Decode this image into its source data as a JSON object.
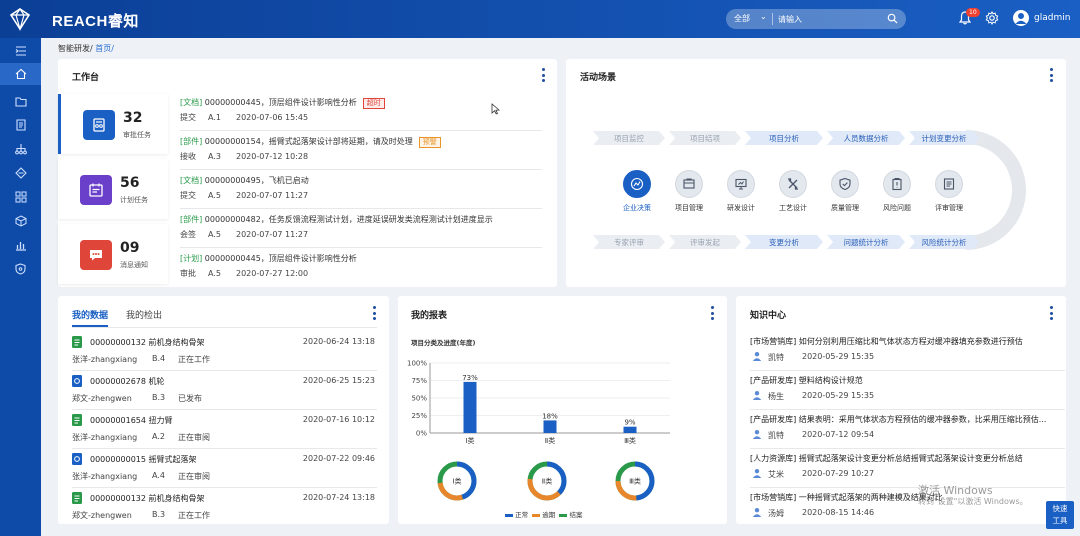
{
  "brand": "REACH睿知",
  "search": {
    "scope": "全部",
    "placeholder": "请输入"
  },
  "notifications": {
    "count": "10"
  },
  "user": {
    "name": "gladmin"
  },
  "breadcrumb": {
    "root": "智能研发/",
    "current": "首页/"
  },
  "workbench": {
    "title": "工作台",
    "stats": [
      {
        "value": "32",
        "label": "审批任务",
        "color": "#1a5fc4"
      },
      {
        "value": "56",
        "label": "计划任务",
        "color": "#6a3fc9"
      },
      {
        "value": "09",
        "label": "消息通知",
        "color": "#e0453a"
      }
    ],
    "tasks": [
      {
        "tag": "[文档]",
        "title": "00000000445，顶层组件设计影响性分析",
        "flag": "超时",
        "flag_color": "#e0453a",
        "action": "提交",
        "version": "A.1",
        "time": "2020-07-06 15:45"
      },
      {
        "tag": "[部件]",
        "title": "00000000154，摇臂式起落架设计部将延期，请及时处理",
        "flag": "预警",
        "flag_color": "#e8962c",
        "action": "接收",
        "version": "A.3",
        "time": "2020-07-12 10:28"
      },
      {
        "tag": "[文档]",
        "title": "00000000495，飞机已启动",
        "flag": "",
        "flag_color": "",
        "action": "提交",
        "version": "A.5",
        "time": "2020-07-07 11:27"
      },
      {
        "tag": "[部件]",
        "title": "00000000482，任务反馈流程测试计划，进度延误研发类流程测试计划进度显示",
        "flag": "",
        "flag_color": "",
        "action": "会签",
        "version": "A.5",
        "time": "2020-07-07 11:27"
      },
      {
        "tag": "[计划]",
        "title": "00000000445，顶层组件设计影响性分析",
        "flag": "",
        "flag_color": "",
        "action": "审批",
        "version": "A.5",
        "time": "2020-07-27 12:00"
      }
    ]
  },
  "scenes": {
    "title": "活动场景",
    "flow_top": [
      "项目监控",
      "项目结项",
      "项目分析",
      "人员数据分析",
      "计划变更分析"
    ],
    "flow_bottom": [
      "专家评审",
      "评审发起",
      "变更分析",
      "问题统计分析",
      "风险统计分析"
    ],
    "items": [
      "企业决策",
      "项目管理",
      "研发设计",
      "工艺设计",
      "质量管理",
      "风险问题",
      "评审管理"
    ]
  },
  "my_data": {
    "tabs": [
      "我的数据",
      "我的检出"
    ],
    "rows": [
      {
        "icon": "doc",
        "name": "00000000132 前机身结构骨架",
        "date": "2020-06-24 13:18",
        "author": "张洋-zhangxiang",
        "version": "B.4",
        "status": "正在工作"
      },
      {
        "icon": "part",
        "name": "00000002678 机轮",
        "date": "2020-06-25 15:23",
        "author": "郑文-zhengwen",
        "version": "B.3",
        "status": "已发布"
      },
      {
        "icon": "doc",
        "name": "00000001654 扭力臂",
        "date": "2020-07-16 10:12",
        "author": "张洋-zhangxiang",
        "version": "A.2",
        "status": "正在审阅"
      },
      {
        "icon": "part",
        "name": "00000000015 摇臂式起落架",
        "date": "2020-07-22 09:46",
        "author": "张洋-zhangxiang",
        "version": "A.4",
        "status": "正在审阅"
      },
      {
        "icon": "doc",
        "name": "00000000132 前机身结构骨架",
        "date": "2020-07-24 13:18",
        "author": "郑文-zhengwen",
        "version": "B.3",
        "status": "正在工作"
      }
    ]
  },
  "report": {
    "title": "我的报表",
    "subtitle": "项目分类及进度(年度)",
    "donuts": [
      "Ⅰ类",
      "Ⅱ类",
      "Ⅲ类"
    ],
    "legend": [
      {
        "name": "正常",
        "color": "#1a5fc4"
      },
      {
        "name": "逾期",
        "color": "#e8862c"
      },
      {
        "name": "结案",
        "color": "#2a9a4a"
      }
    ]
  },
  "chart_data": {
    "type": "bar",
    "title": "项目分类及进度(年度)",
    "categories": [
      "Ⅰ类",
      "Ⅱ类",
      "Ⅲ类"
    ],
    "values": [
      73,
      18,
      9
    ],
    "value_labels": [
      "73%",
      "18%",
      "9%"
    ],
    "yticks": [
      "0%",
      "25%",
      "50%",
      "75%",
      "100%"
    ],
    "ylim": [
      0,
      100
    ],
    "bar_color": "#1a5fc4"
  },
  "knowledge": {
    "title": "知识中心",
    "rows": [
      {
        "text": "[市场营销库]   如何分别利用压缩比和气体状态方程对缓冲器填充参数进行预估",
        "person": "凯特",
        "date": "2020-05-29 15:35"
      },
      {
        "text": "[产品研发库]   塑料结构设计规范",
        "person": "杨生",
        "date": "2020-05-29 15:35"
      },
      {
        "text": "[产品研发库]   结果表明：采用气体状态方程预估的缓冲器参数，比采用压缩比预估...",
        "person": "凯特",
        "date": "2020-07-12 09:54"
      },
      {
        "text": "[人力资源库]   摇臂式起落架设计变更分析总结摇臂式起落架设计变更分析总结",
        "person": "艾米",
        "date": "2020-07-29 10:27"
      },
      {
        "text": "[市场营销库]   一种摇臂式起落架的两种建模及结果对比",
        "person": "汤姆",
        "date": "2020-08-15 14:46"
      }
    ]
  },
  "watermark": {
    "line1": "激活 Windows",
    "line2": "转到\"设置\"以激活 Windows。"
  },
  "quick_tool": {
    "line1": "快速",
    "line2": "工具"
  }
}
